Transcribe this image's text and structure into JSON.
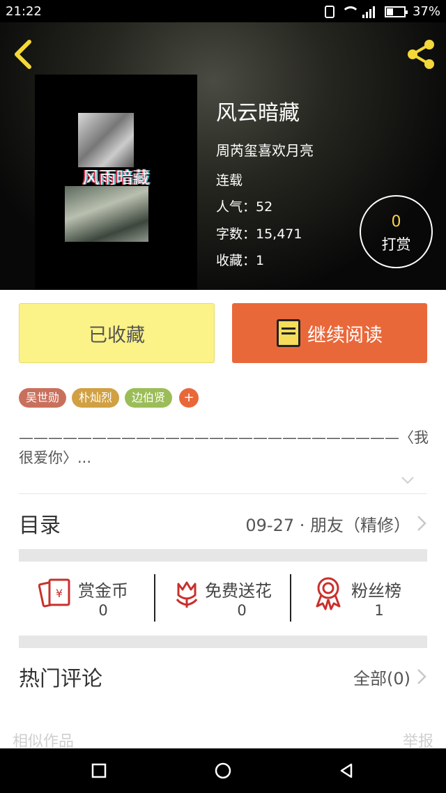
{
  "status_bar": {
    "time": "21:22",
    "battery": "37%"
  },
  "book": {
    "cover_text": "风雨暗藏",
    "title": "风云暗藏",
    "author": "周芮玺喜欢月亮",
    "status": "连载",
    "popularity": "人气：52",
    "word_count": "字数：15,471",
    "favorites": "收藏：1"
  },
  "reward": {
    "count": "0",
    "label": "打赏"
  },
  "actions": {
    "favorite_label": "已收藏",
    "read_label": "继续阅读"
  },
  "tags": [
    {
      "label": "吴世勋",
      "color": "#c9705d"
    },
    {
      "label": "朴灿烈",
      "color": "#d1a042"
    },
    {
      "label": "边伯贤",
      "color": "#9bbd57"
    }
  ],
  "tag_add": "+",
  "description": "——————————————————————————〈我很爱你〉...",
  "toc": {
    "title": "目录",
    "latest": "09-27 · 朋友（精修）"
  },
  "stats": [
    {
      "icon": "red-envelope-coin-icon",
      "label": "赏金币",
      "value": "0"
    },
    {
      "icon": "flower-icon",
      "label": "免费送花",
      "value": "0"
    },
    {
      "icon": "medal-icon",
      "label": "粉丝榜",
      "value": "1"
    }
  ],
  "comments": {
    "title": "热门评论",
    "all": "全部(0)"
  },
  "footer": {
    "similar": "相似作品",
    "report": "举报"
  },
  "colors": {
    "accent": "#e9683a",
    "favorite_bg": "#fbf387",
    "reward_num": "#f6d34a"
  }
}
